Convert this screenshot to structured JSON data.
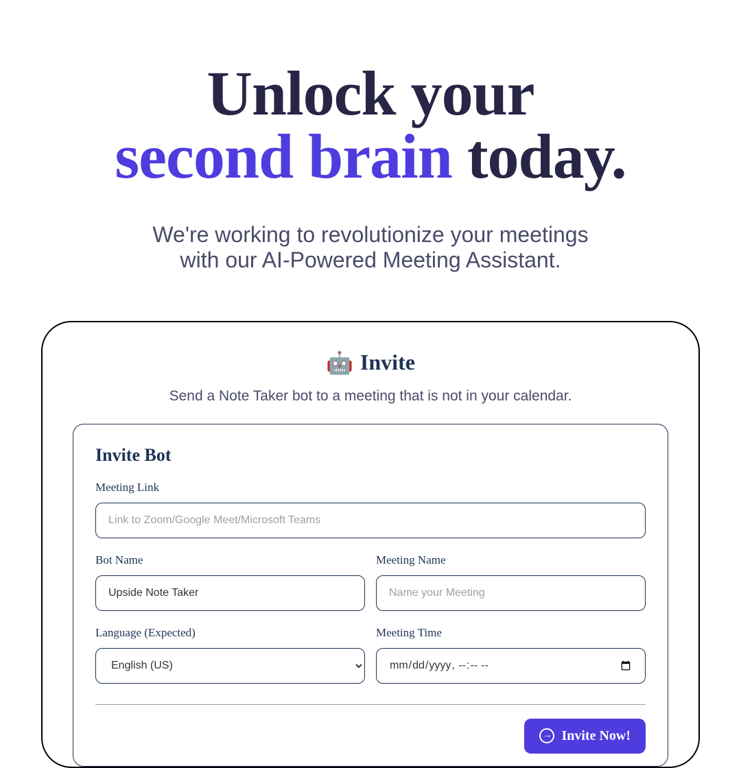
{
  "hero": {
    "line1": "Unlock your",
    "accent": "second brain",
    "line2_end": " today.",
    "subtitle_l1": "We're working to revolutionize your meetings",
    "subtitle_l2": "with our AI-Powered Meeting Assistant."
  },
  "invite": {
    "icon": "🤖",
    "title": "Invite",
    "description": "Send a Note Taker bot to a meeting that is not in your calendar.",
    "form_title": "Invite Bot",
    "fields": {
      "meeting_link": {
        "label": "Meeting Link",
        "placeholder": "Link to Zoom/Google Meet/Microsoft Teams",
        "value": ""
      },
      "bot_name": {
        "label": "Bot Name",
        "value": "Upside Note Taker"
      },
      "meeting_name": {
        "label": "Meeting Name",
        "placeholder": "Name your Meeting",
        "value": ""
      },
      "language": {
        "label": "Language (Expected)",
        "selected": "English (US)",
        "options": [
          "English (US)"
        ]
      },
      "meeting_time": {
        "label": "Meeting Time",
        "placeholder": "mm/dd/yyyy, --:-- --",
        "value": ""
      }
    },
    "submit_label": "Invite Now!"
  }
}
